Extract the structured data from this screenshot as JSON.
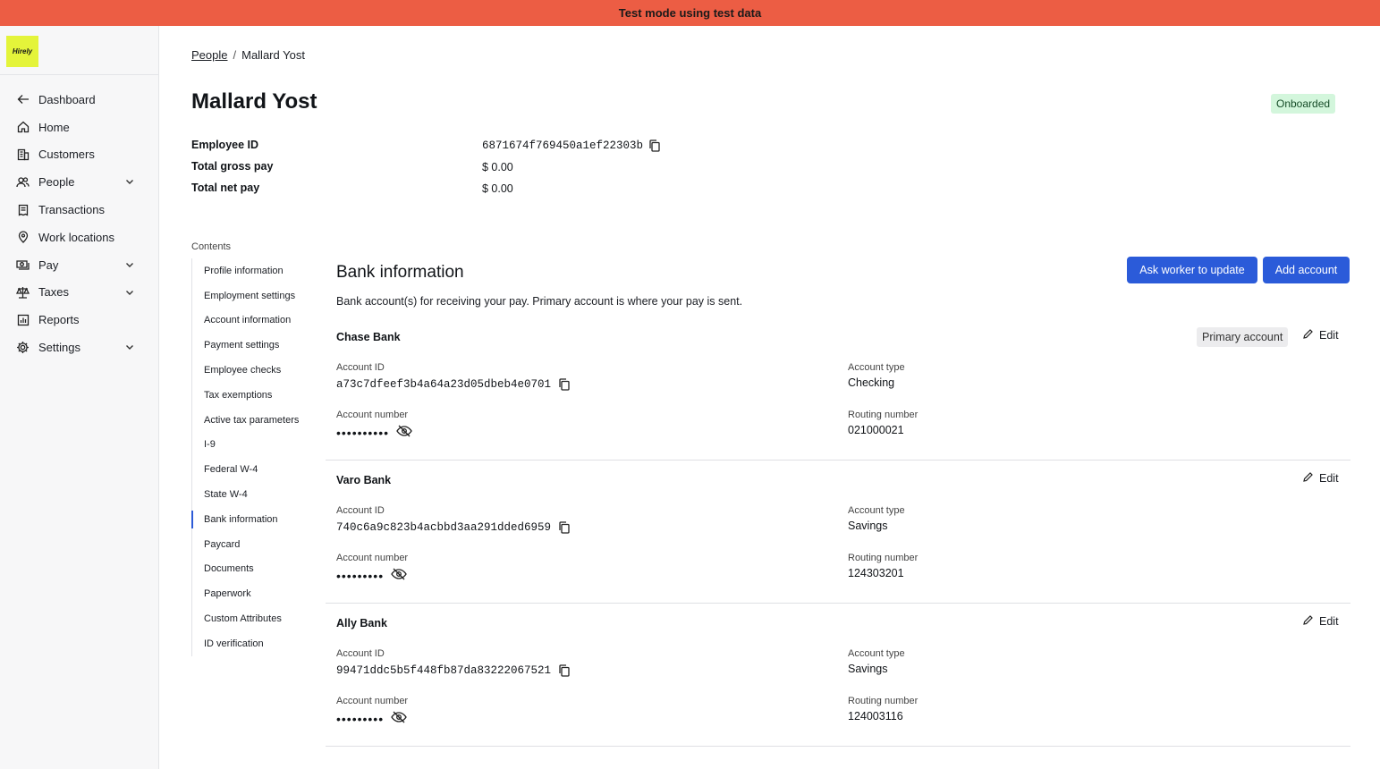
{
  "banner": {
    "text": "Test mode using test data"
  },
  "brand": {
    "logo_text": "Hirely",
    "accent": "#e4f43a"
  },
  "sidebar": {
    "items": [
      {
        "label": "Dashboard",
        "icon": "arrow-left-icon"
      },
      {
        "label": "Home",
        "icon": "home-icon"
      },
      {
        "label": "Customers",
        "icon": "building-icon"
      },
      {
        "label": "People",
        "icon": "people-icon",
        "expandable": true
      },
      {
        "label": "Transactions",
        "icon": "receipt-icon"
      },
      {
        "label": "Work locations",
        "icon": "map-pin-icon"
      },
      {
        "label": "Pay",
        "icon": "cash-icon",
        "expandable": true
      },
      {
        "label": "Taxes",
        "icon": "scale-icon",
        "expandable": true
      },
      {
        "label": "Reports",
        "icon": "chart-icon"
      },
      {
        "label": "Settings",
        "icon": "gear-icon",
        "expandable": true
      }
    ]
  },
  "breadcrumb": {
    "parent": "People",
    "separator": "/",
    "current": "Mallard Yost"
  },
  "employee": {
    "name": "Mallard Yost",
    "status": "Onboarded",
    "summary": [
      {
        "label": "Employee ID",
        "value": "6871674f769450a1ef22303b",
        "copyable": true
      },
      {
        "label": "Total gross pay",
        "value": "$ 0.00"
      },
      {
        "label": "Total net pay",
        "value": "$ 0.00"
      }
    ]
  },
  "contents": {
    "title": "Contents",
    "items": [
      "Profile information",
      "Employment settings",
      "Account information",
      "Payment settings",
      "Employee checks",
      "Tax exemptions",
      "Active tax parameters",
      "I-9",
      "Federal W-4",
      "State W-4",
      "Bank information",
      "Paycard",
      "Documents",
      "Paperwork",
      "Custom Attributes",
      "ID verification"
    ],
    "active": "Bank information"
  },
  "bank_section": {
    "title": "Bank information",
    "description": "Bank account(s) for receiving your pay. Primary account is where your pay is sent.",
    "ask_button": "Ask worker to update",
    "add_button": "Add account",
    "labels": {
      "account_id": "Account ID",
      "account_type": "Account type",
      "account_number": "Account number",
      "routing_number": "Routing number",
      "edit": "Edit",
      "primary": "Primary account"
    },
    "accounts": [
      {
        "bank": "Chase Bank",
        "primary": true,
        "account_id": "a73c7dfeef3b4a64a23d05dbeb4e0701",
        "account_type": "Checking",
        "account_number": "••••••••••",
        "routing_number": "021000021"
      },
      {
        "bank": "Varo Bank",
        "primary": false,
        "account_id": "740c6a9c823b4acbbd3aa291dded6959",
        "account_type": "Savings",
        "account_number": "•••••••••",
        "routing_number": "124303201"
      },
      {
        "bank": "Ally Bank",
        "primary": false,
        "account_id": "99471ddc5b5f448fb87da83222067521",
        "account_type": "Savings",
        "account_number": "•••••••••",
        "routing_number": "124003116"
      }
    ]
  },
  "colors": {
    "banner": "#ec5d44",
    "primary_button": "#2b5bd9",
    "status_badge_bg": "#d3f6dc"
  }
}
